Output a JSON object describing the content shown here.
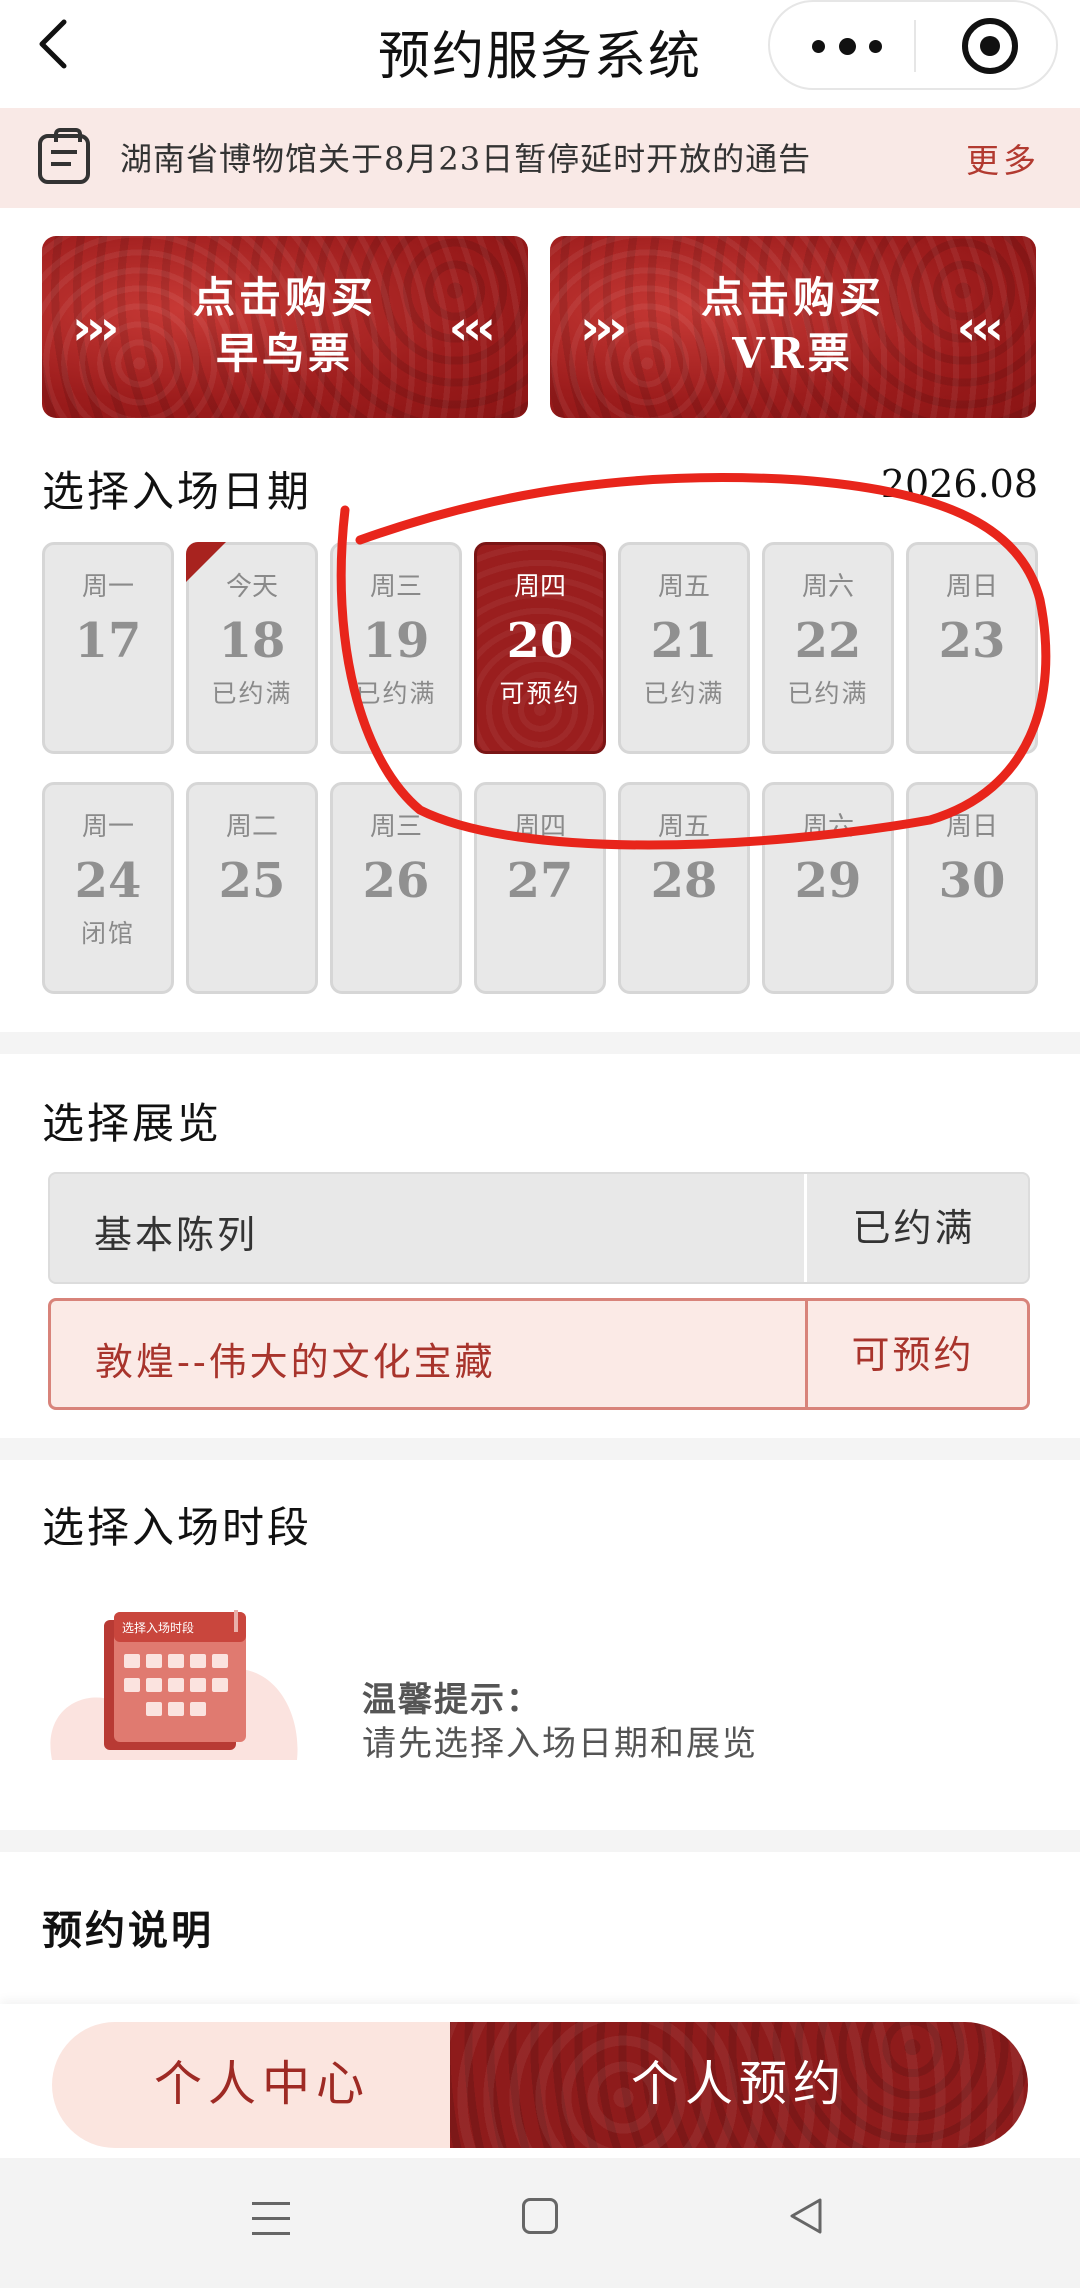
{
  "app": {
    "title": "预约服务系统"
  },
  "notice": {
    "text": "湖南省博物馆关于8月23日暂停延时开放的通告",
    "more": "更多"
  },
  "banners": [
    {
      "line1": "点击购买",
      "line2": "早鸟票"
    },
    {
      "line1": "点击购买",
      "line2": "VR票"
    }
  ],
  "date_section": {
    "title": "选择入场日期",
    "month": "2026.08"
  },
  "calendar": {
    "row1": [
      {
        "weekday": "周一",
        "day": "17",
        "status": ""
      },
      {
        "weekday": "今天",
        "day": "18",
        "status": "已约满"
      },
      {
        "weekday": "周三",
        "day": "19",
        "status": "已约满"
      },
      {
        "weekday": "周四",
        "day": "20",
        "status": "可预约"
      },
      {
        "weekday": "周五",
        "day": "21",
        "status": "已约满"
      },
      {
        "weekday": "周六",
        "day": "22",
        "status": "已约满"
      },
      {
        "weekday": "周日",
        "day": "23",
        "status": ""
      }
    ],
    "row2": [
      {
        "weekday": "周一",
        "day": "24",
        "status": "闭馆"
      },
      {
        "weekday": "周二",
        "day": "25",
        "status": ""
      },
      {
        "weekday": "周三",
        "day": "26",
        "status": ""
      },
      {
        "weekday": "周四",
        "day": "27",
        "status": ""
      },
      {
        "weekday": "周五",
        "day": "28",
        "status": ""
      },
      {
        "weekday": "周六",
        "day": "29",
        "status": ""
      },
      {
        "weekday": "周日",
        "day": "30",
        "status": ""
      }
    ]
  },
  "exhibition_section": {
    "title": "选择展览",
    "items": [
      {
        "name": "基本陈列",
        "status": "已约满"
      },
      {
        "name": "敦煌--伟大的文化宝藏",
        "status": "可预约"
      }
    ]
  },
  "timeslot_section": {
    "title": "选择入场时段",
    "illustration_caption": "选择入场时段",
    "hint_title": "温馨提示：",
    "hint_text": "请先选择入场日期和展览"
  },
  "notes_section": {
    "title": "预约说明"
  },
  "actions": {
    "personal_center": "个人中心",
    "personal_booking": "个人预约"
  },
  "colors": {
    "brand_red": "#9a1e1e",
    "notice_bg": "#f9e9e6",
    "annotation_red": "#e8251b"
  }
}
